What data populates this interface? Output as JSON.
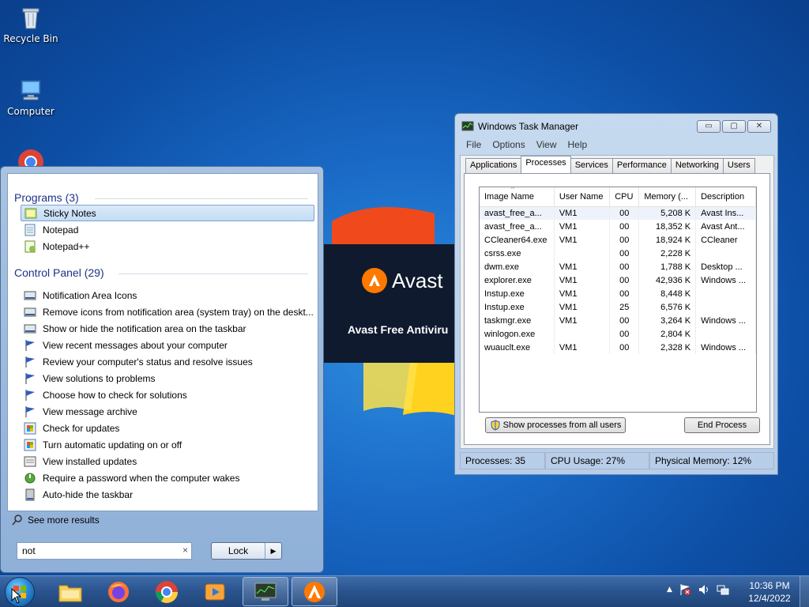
{
  "desktop": {
    "icons": [
      {
        "label": "Recycle Bin",
        "icon": "recycle-bin-icon"
      },
      {
        "label": "Computer",
        "icon": "computer-icon"
      }
    ]
  },
  "avast_splash": {
    "brand": "Avast",
    "subtitle": "Avast Free Antiviru",
    "accent": "#ff7800"
  },
  "start_menu": {
    "programs_title": "Programs",
    "programs_count": "(3)",
    "programs": [
      {
        "label": "Sticky Notes",
        "icon": "sticky-notes-icon"
      },
      {
        "label": "Notepad",
        "icon": "notepad-icon"
      },
      {
        "label": "Notepad++",
        "icon": "notepad-plus-plus-icon"
      }
    ],
    "control_panel_title": "Control Panel",
    "control_panel_count": "(29)",
    "control_panel": [
      {
        "label": "Notification Area Icons",
        "icon": "notification-area-icon"
      },
      {
        "label": "Remove icons from notification area (system tray) on the deskt...",
        "icon": "notification-area-icon"
      },
      {
        "label": "Show or hide the notification area on the taskbar",
        "icon": "notification-area-icon"
      },
      {
        "label": "View recent messages about your computer",
        "icon": "action-center-flag-icon"
      },
      {
        "label": "Review your computer's status and resolve issues",
        "icon": "action-center-flag-icon"
      },
      {
        "label": "View solutions to problems",
        "icon": "action-center-flag-icon"
      },
      {
        "label": "Choose how to check for solutions",
        "icon": "action-center-flag-icon"
      },
      {
        "label": "View message archive",
        "icon": "action-center-flag-icon"
      },
      {
        "label": "Check for updates",
        "icon": "windows-update-icon"
      },
      {
        "label": "Turn automatic updating on or off",
        "icon": "windows-update-icon"
      },
      {
        "label": "View installed updates",
        "icon": "installed-updates-icon"
      },
      {
        "label": "Require a password when the computer wakes",
        "icon": "power-options-icon"
      },
      {
        "label": "Auto-hide the taskbar",
        "icon": "taskbar-icon"
      }
    ],
    "see_more": "See more results",
    "search_value": "not",
    "search_clear": "×",
    "lock_label": "Lock",
    "lock_arrow": "▶"
  },
  "task_manager": {
    "title": "Windows Task Manager",
    "controls": [
      "▭",
      "▢",
      "✕"
    ],
    "menu": [
      "File",
      "Options",
      "View",
      "Help"
    ],
    "tabs": [
      "Applications",
      "Processes",
      "Services",
      "Performance",
      "Networking",
      "Users"
    ],
    "active_tab": "Processes",
    "columns": [
      "Image Name",
      "User Name",
      "CPU",
      "Memory (...",
      "Description"
    ],
    "sort_indicator": "^",
    "rows": [
      [
        "avast_free_a...",
        "VM1",
        "00",
        "5,208 K",
        "Avast Ins..."
      ],
      [
        "avast_free_a...",
        "VM1",
        "00",
        "18,352 K",
        "Avast Ant..."
      ],
      [
        "CCleaner64.exe",
        "VM1",
        "00",
        "18,924 K",
        "CCleaner"
      ],
      [
        "csrss.exe",
        "",
        "00",
        "2,228 K",
        ""
      ],
      [
        "dwm.exe",
        "VM1",
        "00",
        "1,788 K",
        "Desktop ..."
      ],
      [
        "explorer.exe",
        "VM1",
        "00",
        "42,936 K",
        "Windows ..."
      ],
      [
        "Instup.exe",
        "VM1",
        "00",
        "8,448 K",
        ""
      ],
      [
        "Instup.exe",
        "VM1",
        "25",
        "6,576 K",
        ""
      ],
      [
        "taskmgr.exe",
        "VM1",
        "00",
        "3,264 K",
        "Windows ..."
      ],
      [
        "winlogon.exe",
        "",
        "00",
        "2,804 K",
        ""
      ],
      [
        "wuauclt.exe",
        "VM1",
        "00",
        "2,328 K",
        "Windows ..."
      ]
    ],
    "show_all_button": "Show processes from all users",
    "end_process_button": "End Process",
    "status": {
      "processes": "Processes: 35",
      "cpu": "CPU Usage: 27%",
      "memory": "Physical Memory: 12%"
    }
  },
  "taskbar": {
    "pinned": [
      {
        "name": "explorer",
        "icon": "folder-icon"
      },
      {
        "name": "firefox",
        "icon": "firefox-icon"
      },
      {
        "name": "chrome",
        "icon": "chrome-icon"
      },
      {
        "name": "media-player",
        "icon": "media-player-icon"
      },
      {
        "name": "task-manager",
        "icon": "task-manager-icon"
      },
      {
        "name": "avast",
        "icon": "avast-icon"
      }
    ],
    "tray_expand": "▲",
    "time": "10:36 PM",
    "date": "12/4/2022"
  }
}
